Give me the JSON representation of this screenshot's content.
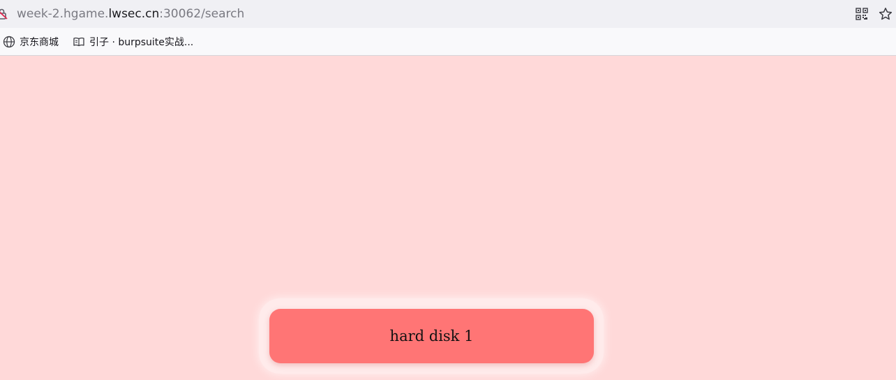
{
  "address_bar": {
    "url_prefix": "week-2.hgame.",
    "url_domain": "lwsec.cn",
    "url_suffix": ":30062/search"
  },
  "bookmarks": [
    {
      "label": "京东商城",
      "icon": "globe-icon"
    },
    {
      "label": "引子 · burpsuite实战...",
      "icon": "book-icon"
    }
  ],
  "main": {
    "disk_label": "hard disk 1"
  },
  "colors": {
    "page_background": "#ffd9d9",
    "disk_button": "#ff7575"
  }
}
